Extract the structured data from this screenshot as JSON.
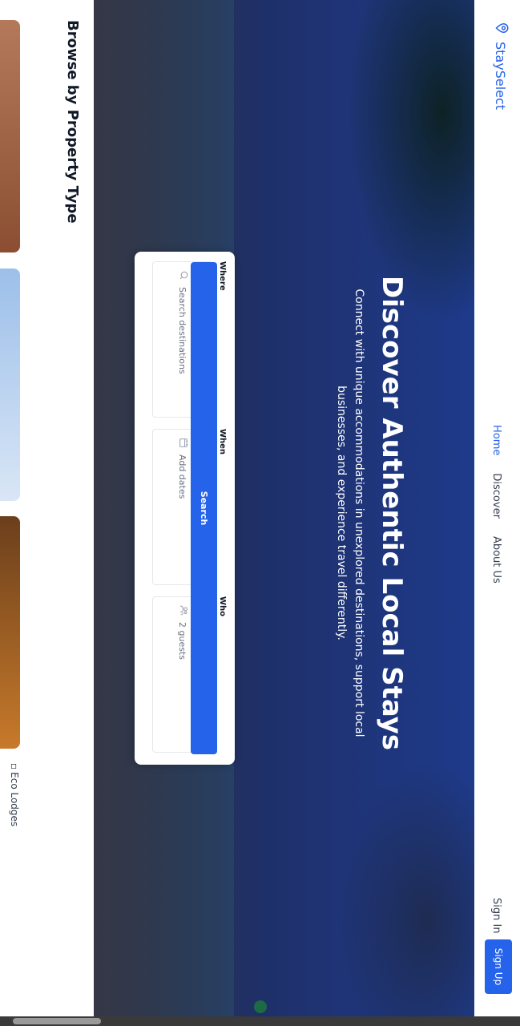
{
  "header": {
    "brand": "StaySelect",
    "nav": [
      {
        "label": "Home",
        "active": true
      },
      {
        "label": "Discover",
        "active": false
      },
      {
        "label": "About Us",
        "active": false
      }
    ],
    "sign_in": "Sign In",
    "sign_up": "Sign Up"
  },
  "hero": {
    "title": "Discover Authentic Local Stays",
    "subtitle": "Connect with unique accommodations in unexplored destinations, support local businesses, and experience travel differently."
  },
  "search": {
    "where_label": "Where",
    "where_placeholder": "Search destinations",
    "when_label": "When",
    "when_value": "Add dates",
    "who_label": "Who",
    "who_value": "2 guests",
    "button": "Search"
  },
  "browse": {
    "title": "Browse by Property Type",
    "eco_label": "Eco Lodges"
  },
  "colors": {
    "accent": "#2563eb"
  }
}
